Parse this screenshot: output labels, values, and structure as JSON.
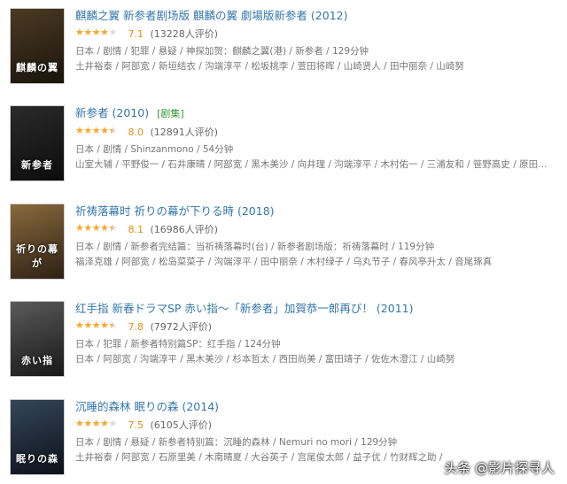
{
  "movies": [
    {
      "title": "麒麟之翼 新参者剧场版 麒麟の翼 劇場版新参者",
      "year": "(2012)",
      "tag": "",
      "rating_fraction": 0.7,
      "score": "7.1",
      "count": "(13228人评价)",
      "meta_line1": "日本 / 剧情 / 犯罪 / 悬疑 / 神探加贺：麒麟之翼(港) / 新参者 / 129分钟",
      "meta_line2": "土井裕泰 / 阿部宽 / 新垣结衣 / 沟端淳平 / 松坂桃李 / 萱田将晖 / 山崎贤人 / 田中丽奈 / 山崎努",
      "poster_text": "麒麟の翼",
      "poster_colors": [
        "#4b3a22",
        "#1a140c"
      ]
    },
    {
      "title": "新参者",
      "year": "(2010)",
      "tag": "[剧集]",
      "rating_fraction": 0.8,
      "score": "8.0",
      "count": "(12891人评价)",
      "meta_line1": "日本 / 剧情 / Shinzanmono / 54分钟",
      "meta_line2": "山室大辅 / 平野俊一 / 石井康晴 / 阿部宽 / 黑木美沙 / 向井理 / 沟端淳平 / 木村佑一 / 三浦友和 / 笹野高史 / 原田…",
      "poster_text": "新参者",
      "poster_colors": [
        "#2a2a2a",
        "#0c0c0c"
      ]
    },
    {
      "title": "祈祷落幕时 祈りの幕が下りる時",
      "year": "(2018)",
      "tag": "",
      "rating_fraction": 0.8,
      "score": "8.1",
      "count": "(16986人评价)",
      "meta_line1": "日本 / 剧情 / 新参者完结篇：当祈祷落幕时(台) / 新参者剧场版：祈祷落幕时 / 119分钟",
      "meta_line2": "福泽克雄 / 阿部宽 / 松岛菜菜子 / 沟端淳平 / 田中丽奈 / 木村绿子 / 乌丸节子 / 春风亭升太 / 音尾琢真",
      "poster_text": "祈りの幕が",
      "poster_colors": [
        "#8a6a3e",
        "#2d2014"
      ]
    },
    {
      "title": "红手指 新春ドラマSP 赤い指～「新参者」加賀恭一郎再び！",
      "year": "(2011)",
      "tag": "",
      "rating_fraction": 0.8,
      "score": "7.8",
      "count": "(7972人评价)",
      "meta_line1": "日本 / 犯罪 / 新参者特别篇SP：红手指 / 124分钟",
      "meta_line2": "日本 / 阿部宽 / 沟端淳平 / 黑木美沙 / 杉本哲太 / 西田尚美 / 富田靖子 / 佐佐木澄江 / 山崎努",
      "poster_text": "赤い指",
      "poster_colors": [
        "#5a5a5a",
        "#181818"
      ]
    },
    {
      "title": "沉睡的森林 眠りの森",
      "year": "(2014)",
      "tag": "",
      "rating_fraction": 0.75,
      "score": "7.5",
      "count": "(6105人评价)",
      "meta_line1": "日本 / 剧情 / 悬疑 / 新参者特别篇：沉睡的森林 / Nemuri no mori / 129分钟",
      "meta_line2": "土井裕泰 / 阿部宽 / 石原里美 / 木南晴夏 / 大谷英子 / 宫尾俊太郎 / 益子优 / 竹财辉之助 /",
      "poster_text": "眠りの森",
      "poster_colors": [
        "#34465a",
        "#0d1118"
      ]
    }
  ],
  "stars_glyphs": "★★★★★",
  "watermark": "头条 @影片探寻人"
}
